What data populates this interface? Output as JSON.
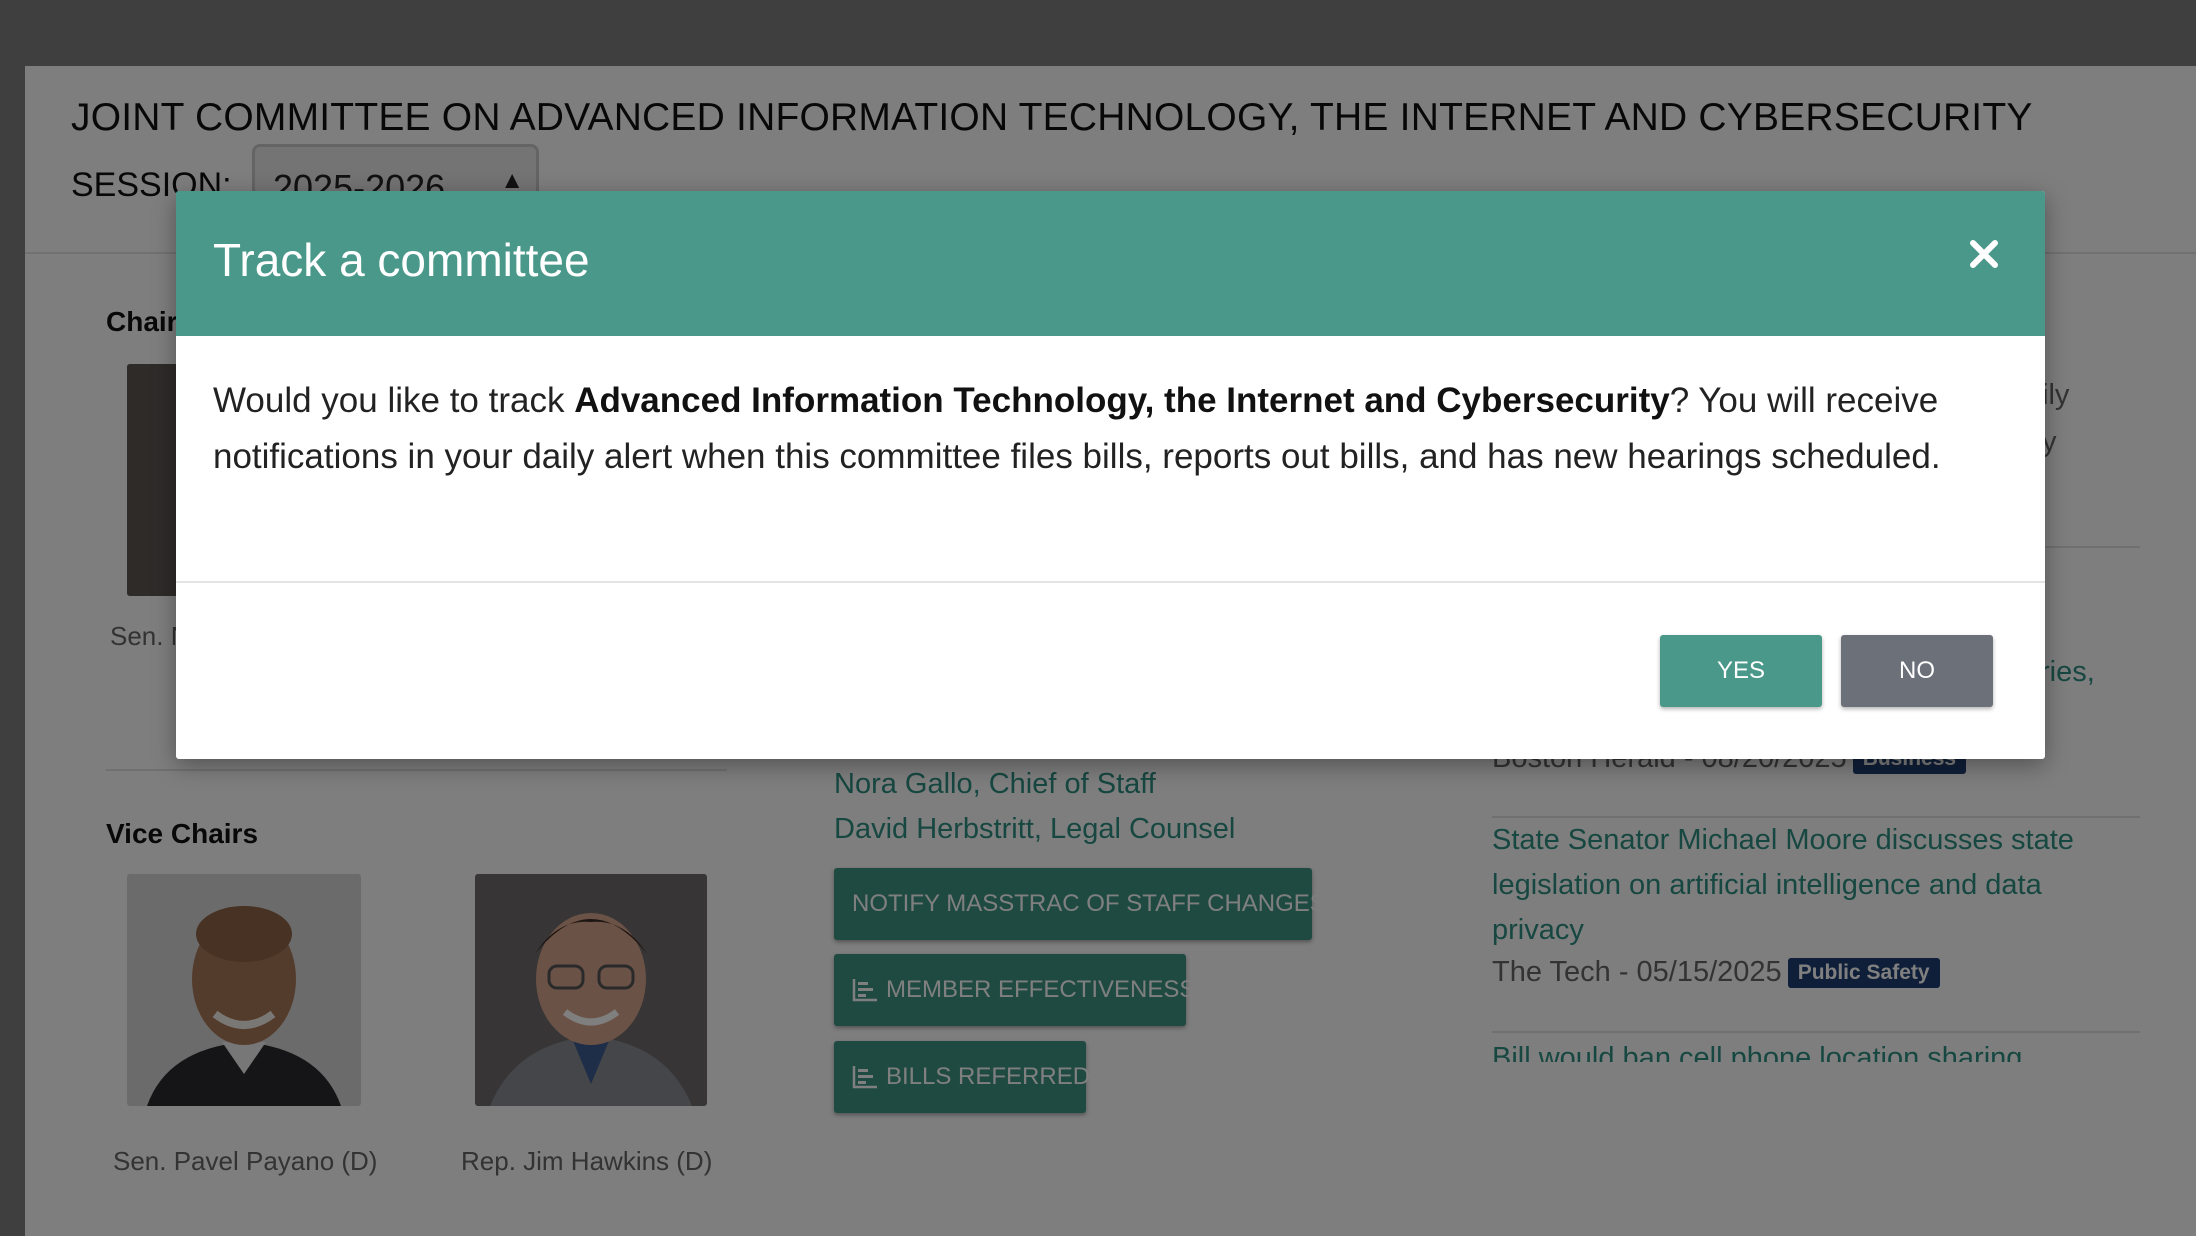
{
  "committee": {
    "title": "JOINT COMMITTEE ON ADVANCED INFORMATION TECHNOLOGY, THE INTERNET AND CYBERSECURITY",
    "session_label": "SESSION:",
    "session_value": "2025-2026"
  },
  "chairs": {
    "heading_fragment": "Chair",
    "name_fragment": "Sen. N"
  },
  "vice_chairs": {
    "heading": "Vice Chairs",
    "members": [
      {
        "name": "Sen. Pavel Payano (D)"
      },
      {
        "name": "Rep. Jim Hawkins (D)"
      }
    ]
  },
  "staff": {
    "links": [
      "Nora Gallo, Chief of Staff",
      "David Herbstritt, Legal Counsel"
    ],
    "buttons": [
      {
        "label": "NOTIFY MASSTRAC OF STAFF CHANGES",
        "icon": ""
      },
      {
        "label": "MEMBER EFFECTIVENESS",
        "icon": "bar-chart-icon"
      },
      {
        "label": "BILLS REFERRED",
        "icon": "bar-chart-icon"
      }
    ]
  },
  "news": {
    "fragments": [
      "ily",
      "y",
      "ries,"
    ],
    "items": [
      {
        "meta": "Boston Herald - 08/20/2025",
        "badge": "Business"
      },
      {
        "title": "State Senator Michael Moore discusses state legislation on artificial intelligence and data privacy",
        "meta": "The Tech - 05/15/2025",
        "badge": "Public Safety"
      },
      {
        "title": "Bill would ban cell phone location sharing"
      }
    ]
  },
  "modal": {
    "title": "Track a committee",
    "close_icon": "close-icon",
    "body_prefix": "Would you like to track ",
    "body_bold": "Advanced Information Technology, the Internet and Cybersecurity",
    "body_suffix": "? You will receive notifications in your daily alert when this committee files bills, reports out bills, and has new hearings scheduled.",
    "yes_label": "YES",
    "no_label": "NO"
  },
  "colors": {
    "accent_teal": "#49988a",
    "badge_navy": "#1e3f72",
    "no_button_gray": "#6b7079"
  }
}
